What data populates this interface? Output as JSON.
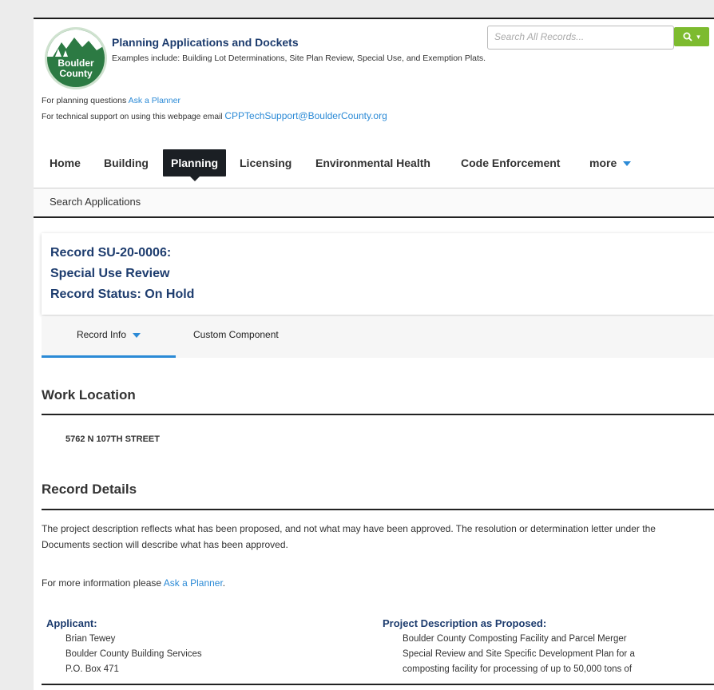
{
  "header": {
    "logo_line1": "Boulder",
    "logo_line2": "County",
    "title": "Planning Applications and Dockets",
    "subtitle": "Examples include: Building Lot Determinations, Site Plan Review, Special Use, and Exemption Plats.",
    "help1_text": "For planning questions ",
    "help1_link": "Ask a Planner",
    "help2_text": "For technical support on using this webpage email ",
    "help2_link": "CPPTechSupport@BoulderCounty.org",
    "search_placeholder": "Search All Records...",
    "search_icon": "magnifier-icon"
  },
  "nav": {
    "items": [
      "Home",
      "Building",
      "Planning",
      "Licensing",
      "Environmental Health",
      "Code Enforcement",
      "more"
    ],
    "active": "Planning"
  },
  "subnav": {
    "label": "Search Applications"
  },
  "record": {
    "line1": "Record SU-20-0006:",
    "line2": "Special Use Review",
    "line3": "Record Status: On Hold"
  },
  "tabs": {
    "record_info": "Record Info",
    "custom_component": "Custom Component"
  },
  "work_location": {
    "title": "Work Location",
    "address": "5762 N 107TH STREET"
  },
  "record_details": {
    "title": "Record Details",
    "disclaimer": "The project description reflects what has been proposed, and not what may have been approved.  The resolution or determination letter under the Documents section will describe what has been approved.",
    "more_info_text": "For more information please ",
    "more_info_link": "Ask a Planner",
    "more_info_suffix": "."
  },
  "applicant": {
    "heading": "Applicant:",
    "lines": [
      "Brian Tewey",
      "Boulder County Building Services",
      "P.O. Box 471"
    ]
  },
  "project_description": {
    "heading": "Project Description as Proposed:",
    "lines": [
      "Boulder County Composting Facility and Parcel Merger",
      "Special Review and Site Specific Development Plan for a",
      "composting facility for processing of up to 50,000 tons of"
    ]
  },
  "colors": {
    "brand_navy": "#1d3c6e",
    "link_blue": "#2b8ad6",
    "search_green": "#7dbb2f",
    "logo_green": "#2c7a43"
  }
}
